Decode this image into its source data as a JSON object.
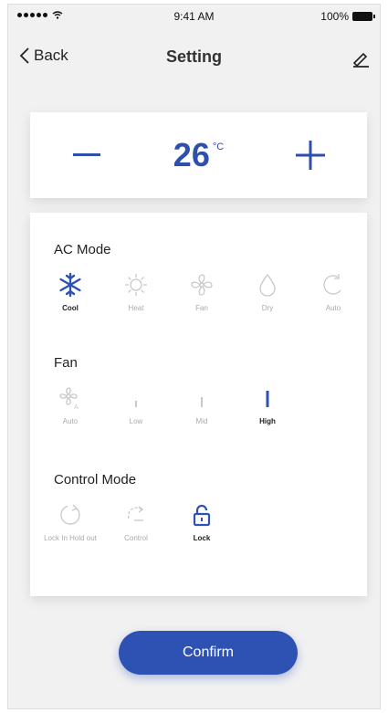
{
  "status_bar": {
    "carrier": "",
    "time": "9:41 AM",
    "battery": "100%"
  },
  "nav": {
    "back_label": "Back",
    "title": "Setting"
  },
  "temperature": {
    "value": "26",
    "unit": "°C"
  },
  "ac_mode": {
    "title": "AC Mode",
    "options": [
      {
        "label": "Cool",
        "icon": "snowflake-icon",
        "active": true
      },
      {
        "label": "Heat",
        "icon": "sun-icon",
        "active": false
      },
      {
        "label": "Fan",
        "icon": "fan-icon",
        "active": false
      },
      {
        "label": "Dry",
        "icon": "droplet-icon",
        "active": false
      },
      {
        "label": "Auto",
        "icon": "auto-icon",
        "active": false
      }
    ]
  },
  "fan": {
    "title": "Fan",
    "options": [
      {
        "label": "Auto",
        "icon": "fan-auto-icon",
        "active": false
      },
      {
        "label": "Low",
        "icon": "fan-low-icon",
        "active": false
      },
      {
        "label": "Mid",
        "icon": "fan-mid-icon",
        "active": false
      },
      {
        "label": "High",
        "icon": "fan-high-icon",
        "active": true
      }
    ]
  },
  "control_mode": {
    "title": "Control Mode",
    "options": [
      {
        "label": "Lock In Hold out",
        "icon": "hold-icon",
        "active": false
      },
      {
        "label": "Control",
        "icon": "control-icon",
        "active": false
      },
      {
        "label": "Lock",
        "icon": "lock-icon",
        "active": true
      }
    ]
  },
  "confirm_label": "Confirm",
  "colors": {
    "accent": "#2d52b4",
    "inactive": "#c8c8c8",
    "background": "#f1f1f1"
  }
}
